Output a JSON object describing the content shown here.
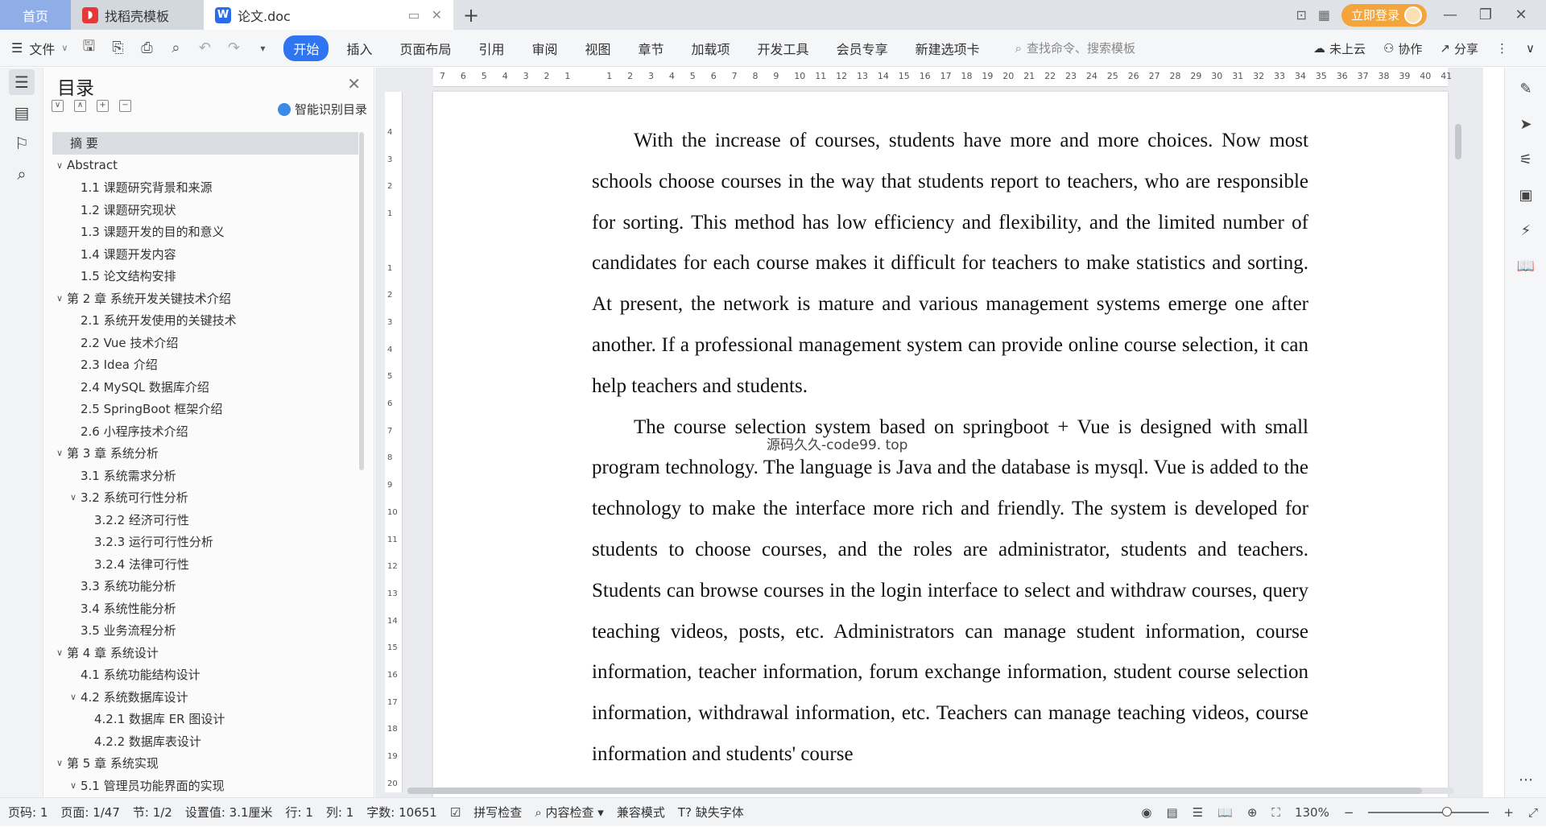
{
  "titlebar": {
    "tabs": [
      {
        "label": "首页"
      },
      {
        "label": "找稻壳模板"
      },
      {
        "label": "论文.doc"
      }
    ],
    "login_label": "立即登录"
  },
  "ribbon": {
    "file_label": "文件",
    "tabs": [
      "开始",
      "插入",
      "页面布局",
      "引用",
      "审阅",
      "视图",
      "章节",
      "加载项",
      "开发工具",
      "会员专享",
      "新建选项卡"
    ],
    "search_placeholder": "查找命令、搜索模板",
    "right": {
      "cloud": "未上云",
      "collab": "协作",
      "share": "分享"
    }
  },
  "toc": {
    "title": "目录",
    "smart_label": "智能识别目录",
    "items": [
      {
        "label": "摘  要",
        "level": 0,
        "chev": ""
      },
      {
        "label": "Abstract",
        "level": 0,
        "chev": "∨"
      },
      {
        "label": "1.1 课题研究背景和来源",
        "level": 1,
        "chev": ""
      },
      {
        "label": "1.2 课题研究现状",
        "level": 1,
        "chev": ""
      },
      {
        "label": "1.3 课题开发的目的和意义",
        "level": 1,
        "chev": ""
      },
      {
        "label": "1.4 课题开发内容",
        "level": 1,
        "chev": ""
      },
      {
        "label": "1.5 论文结构安排",
        "level": 1,
        "chev": ""
      },
      {
        "label": "第 2 章  系统开发关键技术介绍",
        "level": 0,
        "chev": "∨"
      },
      {
        "label": "2.1 系统开发使用的关键技术",
        "level": 1,
        "chev": ""
      },
      {
        "label": "2.2 Vue 技术介绍",
        "level": 1,
        "chev": ""
      },
      {
        "label": "2.3 Idea 介绍",
        "level": 1,
        "chev": ""
      },
      {
        "label": "2.4 MySQL 数据库介绍",
        "level": 1,
        "chev": ""
      },
      {
        "label": "2.5 SpringBoot 框架介绍",
        "level": 1,
        "chev": ""
      },
      {
        "label": "2.6 小程序技术介绍",
        "level": 1,
        "chev": ""
      },
      {
        "label": "第 3 章  系统分析",
        "level": 0,
        "chev": "∨"
      },
      {
        "label": "3.1 系统需求分析",
        "level": 1,
        "chev": ""
      },
      {
        "label": "3.2 系统可行性分析",
        "level": 1,
        "chev": "∨"
      },
      {
        "label": "3.2.2 经济可行性",
        "level": 2,
        "chev": ""
      },
      {
        "label": "3.2.3 运行可行性分析",
        "level": 2,
        "chev": ""
      },
      {
        "label": "3.2.4 法律可行性",
        "level": 2,
        "chev": ""
      },
      {
        "label": "3.3 系统功能分析",
        "level": 1,
        "chev": ""
      },
      {
        "label": "3.4 系统性能分析",
        "level": 1,
        "chev": ""
      },
      {
        "label": "3.5 业务流程分析",
        "level": 1,
        "chev": ""
      },
      {
        "label": "第 4 章  系统设计",
        "level": 0,
        "chev": "∨"
      },
      {
        "label": "4.1 系统功能结构设计",
        "level": 1,
        "chev": ""
      },
      {
        "label": "4.2 系统数据库设计",
        "level": 1,
        "chev": "∨"
      },
      {
        "label": "4.2.1 数据库 ER 图设计",
        "level": 2,
        "chev": ""
      },
      {
        "label": "4.2.2 数据库表设计",
        "level": 2,
        "chev": ""
      },
      {
        "label": "第 5 章  系统实现",
        "level": 0,
        "chev": "∨"
      },
      {
        "label": "5.1 管理员功能界面的实现",
        "level": 1,
        "chev": "∨"
      }
    ]
  },
  "ruler": {
    "h": [
      "7",
      "6",
      "5",
      "4",
      "3",
      "2",
      "1",
      "",
      "1",
      "2",
      "3",
      "4",
      "5",
      "6",
      "7",
      "8",
      "9",
      "10",
      "11",
      "12",
      "13",
      "14",
      "15",
      "16",
      "17",
      "18",
      "19",
      "20",
      "21",
      "22",
      "23",
      "24",
      "25",
      "26",
      "27",
      "28",
      "29",
      "30",
      "31",
      "32",
      "33",
      "34",
      "35",
      "36",
      "37",
      "38",
      "39",
      "40",
      "41"
    ],
    "v": [
      "4",
      "3",
      "2",
      "1",
      "",
      "1",
      "2",
      "3",
      "4",
      "5",
      "6",
      "7",
      "8",
      "9",
      "10",
      "11",
      "12",
      "13",
      "14",
      "15",
      "16",
      "17",
      "18",
      "19",
      "20"
    ]
  },
  "document": {
    "paragraph1": "With the increase of courses, students have more and more choices. Now most schools choose courses in the way that students report to teachers, who are responsible for sorting. This method has low efficiency and flexibility, and the limited number of candidates for each course makes it difficult for teachers to make statistics and sorting. At present, the network is mature and various management systems emerge one after another. If a professional management system can provide online course selection, it can help teachers and students.",
    "paragraph2": "The course selection system based on springboot + Vue is designed with small program technology. The language is Java and the database is mysql. Vue is added to the technology to make the interface more rich and friendly. The system is developed for students to choose courses, and the roles are administrator, students and teachers. Students can browse courses in the login interface to select and withdraw courses, query teaching videos, posts, etc. Administrators can manage student information, course information, teacher information, forum exchange information, student course selection information, withdrawal information, etc. Teachers can manage teaching videos, course information and students' course",
    "watermark": "源码久久-code99. top"
  },
  "status": {
    "page_num": "页码: 1",
    "pages": "页面: 1/47",
    "section": "节: 1/2",
    "setting": "设置值: 3.1厘米",
    "row": "行: 1",
    "col": "列: 1",
    "words": "字数: 10651",
    "spell": "拼写检查",
    "content_check": "内容检查",
    "compat": "兼容模式",
    "missing_font": "缺失字体",
    "zoom": "130%"
  },
  "colors": {
    "accent": "#2f74f0",
    "home_tab": "#8faee8",
    "login": "#f3a43a"
  }
}
